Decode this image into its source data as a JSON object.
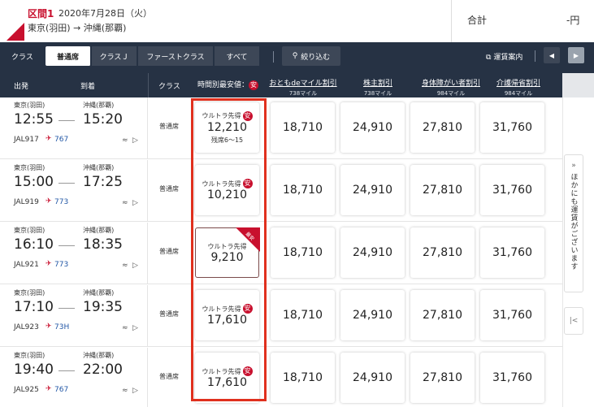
{
  "header": {
    "segment_label": "区間1",
    "date": "2020年7月28日（火）",
    "route": "東京(羽田) → 沖縄(那覇)",
    "total_label": "合計",
    "total_value": "-円"
  },
  "class_bar": {
    "label": "クラス",
    "tabs": [
      "普通席",
      "クラスＪ",
      "ファーストクラス",
      "すべて"
    ],
    "active_tab": "普通席",
    "filter_label": "絞り込む",
    "fare_info_label": "運賃案内"
  },
  "columns": {
    "departure": "出発",
    "arrival": "到着",
    "class": "クラス",
    "cheapest": "時間別最安値：",
    "cheap_badge": "安",
    "discounts": [
      {
        "name": "おともdeマイル割引",
        "miles": "738マイル"
      },
      {
        "name": "株主割引",
        "miles": "738マイル"
      },
      {
        "name": "身体障がい者割引",
        "miles": "984マイル"
      },
      {
        "name": "介護帰省割引",
        "miles": "984マイル"
      }
    ]
  },
  "flights": [
    {
      "dep_airport": "東京(羽田)",
      "arr_airport": "沖縄(那覇)",
      "dep_time": "12:55",
      "arr_time": "15:20",
      "flight_no": "JAL917",
      "aircraft": "767",
      "class": "普通席",
      "fare_name": "ウルトラ先得",
      "cheapest_price": "12,210",
      "seats": "残席6〜15",
      "selected": false,
      "prices": [
        "18,710",
        "24,910",
        "27,810",
        "31,760"
      ]
    },
    {
      "dep_airport": "東京(羽田)",
      "arr_airport": "沖縄(那覇)",
      "dep_time": "15:00",
      "arr_time": "17:25",
      "flight_no": "JAL919",
      "aircraft": "773",
      "class": "普通席",
      "fare_name": "ウルトラ先得",
      "cheapest_price": "10,210",
      "seats": "",
      "selected": false,
      "prices": [
        "18,710",
        "24,910",
        "27,810",
        "31,760"
      ]
    },
    {
      "dep_airport": "東京(羽田)",
      "arr_airport": "沖縄(那覇)",
      "dep_time": "16:10",
      "arr_time": "18:35",
      "flight_no": "JAL921",
      "aircraft": "773",
      "class": "普通席",
      "fare_name": "ウルトラ先得",
      "cheapest_price": "9,210",
      "seats": "",
      "selected": true,
      "ribbon": "最安",
      "prices": [
        "18,710",
        "24,910",
        "27,810",
        "31,760"
      ]
    },
    {
      "dep_airport": "東京(羽田)",
      "arr_airport": "沖縄(那覇)",
      "dep_time": "17:10",
      "arr_time": "19:35",
      "flight_no": "JAL923",
      "aircraft": "73H",
      "class": "普通席",
      "fare_name": "ウルトラ先得",
      "cheapest_price": "17,610",
      "seats": "",
      "selected": false,
      "prices": [
        "18,710",
        "24,910",
        "27,810",
        "31,760"
      ]
    },
    {
      "dep_airport": "東京(羽田)",
      "arr_airport": "沖縄(那覇)",
      "dep_time": "19:40",
      "arr_time": "22:00",
      "flight_no": "JAL925",
      "aircraft": "767",
      "class": "普通席",
      "fare_name": "ウルトラ先得",
      "cheapest_price": "17,610",
      "seats": "",
      "selected": false,
      "prices": [
        "18,710",
        "24,910",
        "27,810",
        "31,760"
      ]
    }
  ],
  "side_panel": {
    "label": "ほかにも運賃がございます"
  },
  "colors": {
    "brand_red": "#c8102e",
    "nav_bg": "#263244",
    "highlight": "#e0301e"
  }
}
